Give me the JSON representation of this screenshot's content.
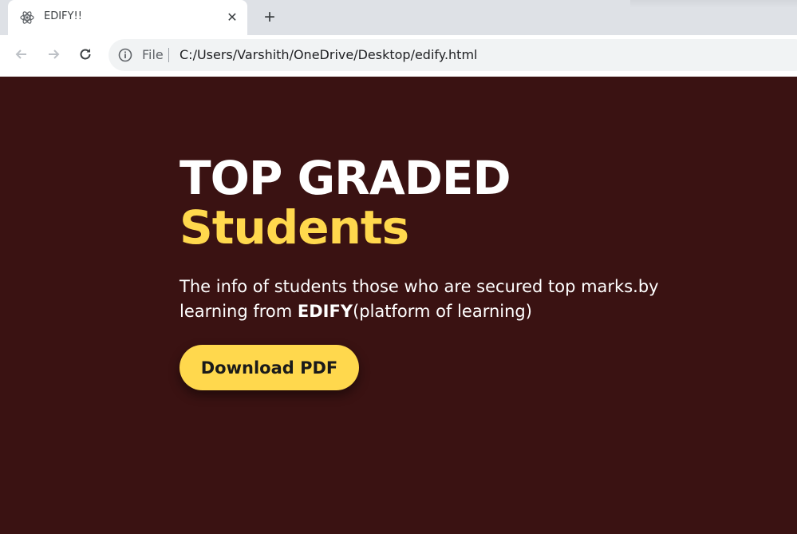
{
  "browser": {
    "tab": {
      "title": "EDIFY!!",
      "favicon": "atom-icon"
    },
    "address_bar": {
      "scheme_label": "File",
      "url": "C:/Users/Varshith/OneDrive/Desktop/edify.html"
    }
  },
  "hero": {
    "headline": "TOP GRADED",
    "headline_accent": "Students",
    "description_before": "The info of students those who are secured top marks.by learning from ",
    "description_brand": "EDIFY",
    "description_after": "(platform of learning)",
    "download_label": "Download PDF"
  },
  "colors": {
    "background": "#3a1212",
    "accent": "#ffd84d",
    "text": "#ffffff"
  }
}
